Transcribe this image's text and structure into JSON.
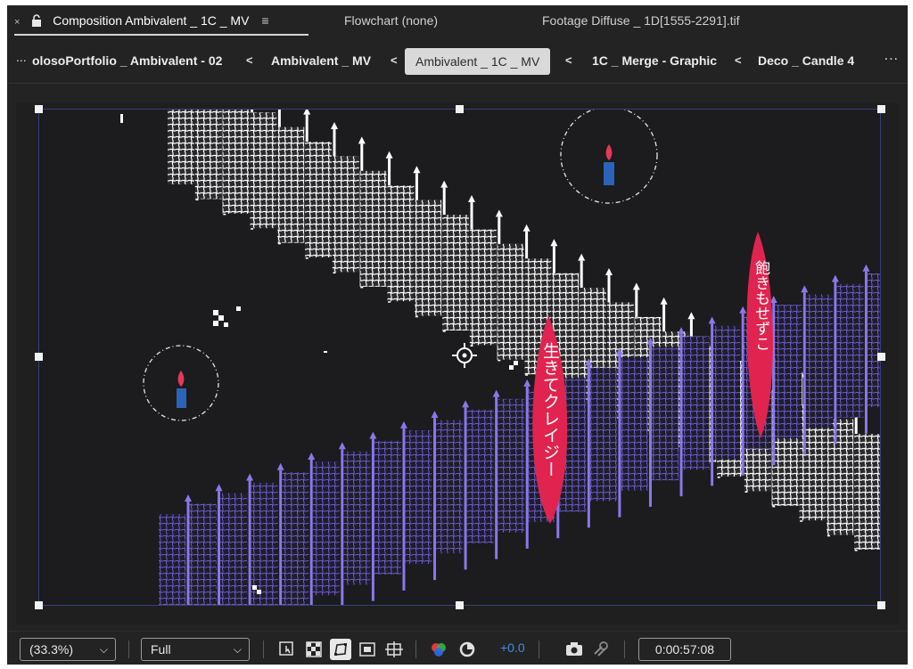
{
  "panel_tabs": {
    "composition": {
      "close_glyph": "×",
      "label": "Composition Ambivalent _ 1C _ MV",
      "menu_glyph": "≡"
    },
    "flowchart": "Flowchart (none)",
    "footage": "Footage Diffuse _ 1D[1555-2291].tif"
  },
  "comp_nav": {
    "overflow_left": "...",
    "items": [
      "olosoPortfolio _ Ambivalent - 02",
      "Ambivalent _ MV",
      "Ambivalent _ 1C _ MV",
      "1C _ Merge - Graphic",
      "Deco _ Candle 4"
    ],
    "separator": "<",
    "active_index": 2,
    "overflow_right": "..."
  },
  "viewer": {
    "banner_left_text": "生きてクレイジー",
    "banner_right_text": "飽きもせずこ",
    "colors": {
      "background": "#1c1b1d",
      "white_lattice": "#ffffff",
      "purple_lattice": "#7a6ad6",
      "banner_red": "#e0244f",
      "candle_flame": "#e23a58",
      "candle_body": "#2a64b8"
    },
    "icons": [
      "candle-icon",
      "lattice-strip",
      "anchor-point-icon"
    ]
  },
  "bottom_bar": {
    "zoom": "(33.3%)",
    "resolution": "Full",
    "exposure": "+0.0",
    "timecode": "0:00:57:08",
    "icons": [
      "region-of-interest-icon",
      "transparency-grid-icon",
      "mask-visibility-icon",
      "guides-icon",
      "grid-icon",
      "color-channels-icon",
      "reset-exposure-icon",
      "snapshot-icon",
      "show-snapshot-icon"
    ],
    "colors": {
      "exposure": "#3d8fe8",
      "active_toggle": "#e8e8e8"
    }
  }
}
